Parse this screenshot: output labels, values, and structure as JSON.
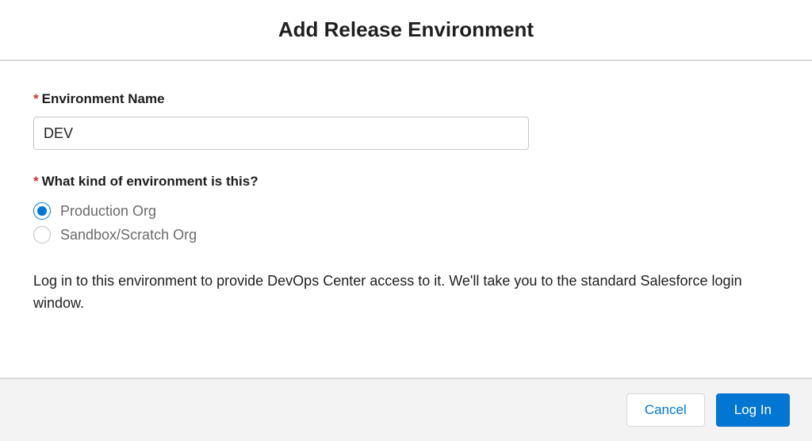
{
  "header": {
    "title": "Add Release Environment"
  },
  "form": {
    "envName": {
      "label": "Environment Name",
      "value": "DEV",
      "required": true
    },
    "envKind": {
      "label": "What kind of environment is this?",
      "required": true,
      "options": [
        {
          "id": "prod",
          "label": "Production Org",
          "selected": true
        },
        {
          "id": "sandbox",
          "label": "Sandbox/Scratch Org",
          "selected": false
        }
      ]
    },
    "infoText": "Log in to this environment to provide DevOps Center access to it. We'll take you to the standard Salesforce login window."
  },
  "footer": {
    "cancelLabel": "Cancel",
    "loginLabel": "Log In"
  },
  "requiredMarker": "*"
}
